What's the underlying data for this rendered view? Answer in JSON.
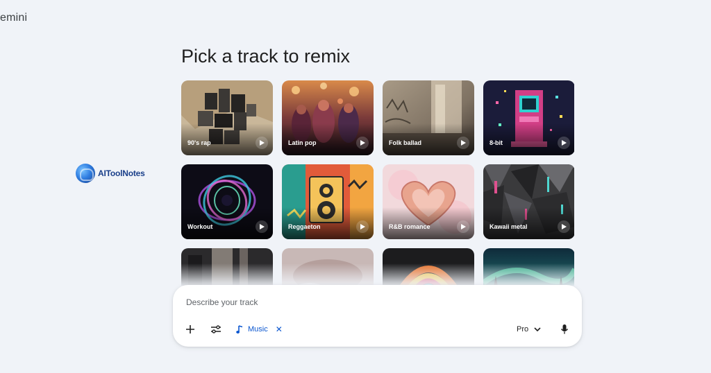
{
  "app": {
    "title": "emini"
  },
  "watermark": {
    "text": "AIToolNotes"
  },
  "main": {
    "heading": "Pick a track to remix",
    "tracks": [
      {
        "label": "90's rap"
      },
      {
        "label": "Latin pop"
      },
      {
        "label": "Folk ballad"
      },
      {
        "label": "8-bit"
      },
      {
        "label": "Workout"
      },
      {
        "label": "Reggaeton"
      },
      {
        "label": "R&B romance"
      },
      {
        "label": "Kawaii metal"
      },
      {
        "label": ""
      },
      {
        "label": ""
      },
      {
        "label": ""
      },
      {
        "label": ""
      }
    ]
  },
  "composer": {
    "placeholder": "Describe your track",
    "chip_label": "Music",
    "chip_close": "✕",
    "model_label": "Pro"
  },
  "icons": {
    "plus": "plus-icon",
    "tune": "tune-icon",
    "music": "music-note-icon",
    "chevron": "chevron-down-icon",
    "mic": "mic-icon",
    "play": "play-icon"
  },
  "colors": {
    "background": "#f0f3f8",
    "accent": "#0b57d0"
  }
}
